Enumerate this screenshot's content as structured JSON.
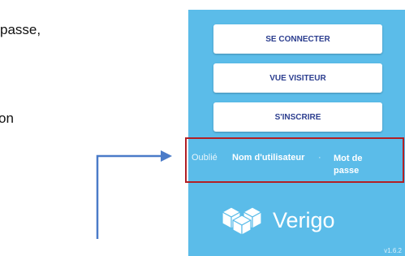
{
  "document": {
    "line1": "passe,",
    "line2": "on"
  },
  "app": {
    "buttons": {
      "login": "SE CONNECTER",
      "visitor": "VUE VISITEUR",
      "signup": "S'INSCRIRE"
    },
    "forgot": {
      "prefix": "Oublié",
      "username": "Nom d'utilisateur",
      "separator": "·",
      "password_line1": "Mot de",
      "password_line2": "passe"
    },
    "logo_text": "Verigo",
    "version": "v1.6.2"
  },
  "colors": {
    "app_background": "#5bbce9",
    "button_text": "#2c3e8f",
    "highlight_border": "#b22025",
    "arrow": "#4a7bc8"
  },
  "icons": {
    "logo": "verigo-cubes-icon"
  }
}
